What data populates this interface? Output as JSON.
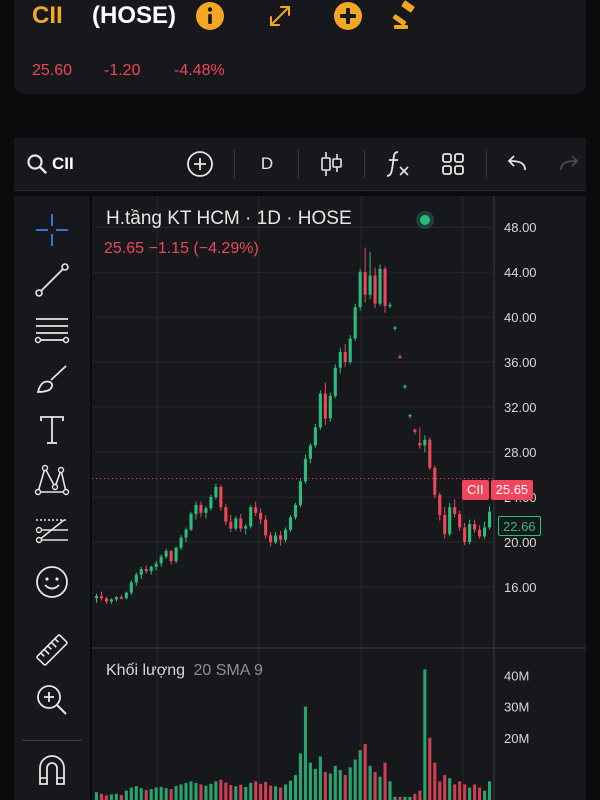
{
  "header": {
    "symbol": "CII",
    "exchange": "(HOSE)",
    "price": "25.60",
    "change": "-1.20",
    "change_pct": "-4.48%",
    "accent_color": "#f5a623",
    "down_color": "#f0455a",
    "icons": [
      "info-icon",
      "expand-icon",
      "add-circle-icon",
      "auction-icon"
    ]
  },
  "toolbar": {
    "search_symbol": "CII",
    "interval": "D",
    "icons": [
      "search-icon",
      "add-indicator-icon",
      "candles-icon",
      "fx-icon",
      "layout-icon",
      "undo-icon",
      "redo-icon"
    ]
  },
  "sidebar": {
    "tools": [
      "crosshair-icon",
      "trendline-icon",
      "fib-lines-icon",
      "brush-icon",
      "text-icon",
      "pattern-icon",
      "forecast-icon",
      "emoji-icon",
      "ruler-icon",
      "zoom-icon",
      "magnet-icon"
    ]
  },
  "chart": {
    "title": "H.tầng KT HCM · 1D · HOSE",
    "ohlc_line": "25.65  −1.15 (−4.29%)",
    "last_label": "CII",
    "last_price": "25.65",
    "ma_price": "22.66",
    "price_axis": [
      "48.00",
      "44.00",
      "40.00",
      "36.00",
      "32.00",
      "28.00",
      "24.00",
      "20.00",
      "16.00"
    ],
    "volume_title": "Khối lượng",
    "volume_params": "20 SMA 9",
    "volume_axis": [
      "40M",
      "30M",
      "20M"
    ],
    "up_color": "#2bbd7e",
    "down_color": "#f0455a"
  },
  "chart_data": {
    "type": "candlestick",
    "ylim": [
      12,
      49
    ],
    "y_ticks": [
      16,
      20,
      24,
      28,
      32,
      36,
      40,
      44,
      48
    ],
    "volume_ylim": [
      0,
      45
    ],
    "candles": [
      [
        15.0,
        15.4,
        14.6,
        15.2
      ],
      [
        15.2,
        15.6,
        14.8,
        15.0
      ],
      [
        15.0,
        15.1,
        14.5,
        14.7
      ],
      [
        14.7,
        15.0,
        14.5,
        14.9
      ],
      [
        14.9,
        15.2,
        14.7,
        15.1
      ],
      [
        15.1,
        15.3,
        14.9,
        15.0
      ],
      [
        15.0,
        15.6,
        14.9,
        15.5
      ],
      [
        15.5,
        16.6,
        15.3,
        16.4
      ],
      [
        16.4,
        17.3,
        16.1,
        17.1
      ],
      [
        17.1,
        17.8,
        16.7,
        17.6
      ],
      [
        17.6,
        17.9,
        17.2,
        17.4
      ],
      [
        17.4,
        17.9,
        17.1,
        17.8
      ],
      [
        17.8,
        18.3,
        17.5,
        18.1
      ],
      [
        18.1,
        18.9,
        17.8,
        18.7
      ],
      [
        18.7,
        19.4,
        18.5,
        19.2
      ],
      [
        19.2,
        19.3,
        18.0,
        18.3
      ],
      [
        18.3,
        19.6,
        18.1,
        19.5
      ],
      [
        19.5,
        20.6,
        19.3,
        20.4
      ],
      [
        20.4,
        21.3,
        20.0,
        21.1
      ],
      [
        21.1,
        22.7,
        21.0,
        22.5
      ],
      [
        22.5,
        23.6,
        22.0,
        23.3
      ],
      [
        23.3,
        23.6,
        22.2,
        22.6
      ],
      [
        22.6,
        23.2,
        22.1,
        23.0
      ],
      [
        23.0,
        24.2,
        22.8,
        24.0
      ],
      [
        24.0,
        25.2,
        23.8,
        24.9
      ],
      [
        24.9,
        25.1,
        22.8,
        23.1
      ],
      [
        23.1,
        23.4,
        21.5,
        21.8
      ],
      [
        21.8,
        22.4,
        20.9,
        21.2
      ],
      [
        21.2,
        22.3,
        21.0,
        22.1
      ],
      [
        22.1,
        22.5,
        20.9,
        21.2
      ],
      [
        21.2,
        21.6,
        20.7,
        21.4
      ],
      [
        21.4,
        23.3,
        21.2,
        23.1
      ],
      [
        23.1,
        23.6,
        22.3,
        22.6
      ],
      [
        22.6,
        23.0,
        21.6,
        22.0
      ],
      [
        22.0,
        22.4,
        20.3,
        20.6
      ],
      [
        20.6,
        20.9,
        19.6,
        20.0
      ],
      [
        20.0,
        20.9,
        19.8,
        20.6
      ],
      [
        20.6,
        21.0,
        19.7,
        20.2
      ],
      [
        20.2,
        21.3,
        20.0,
        21.1
      ],
      [
        21.1,
        22.4,
        20.9,
        22.2
      ],
      [
        22.2,
        23.5,
        22.0,
        23.3
      ],
      [
        23.3,
        25.6,
        23.1,
        25.4
      ],
      [
        25.4,
        27.8,
        25.2,
        27.4
      ],
      [
        27.4,
        28.8,
        27.0,
        28.6
      ],
      [
        28.6,
        30.5,
        28.4,
        30.2
      ],
      [
        30.2,
        33.5,
        30.0,
        33.2
      ],
      [
        33.2,
        34.2,
        30.4,
        31.0
      ],
      [
        31.0,
        33.3,
        30.7,
        33.0
      ],
      [
        33.0,
        35.8,
        32.8,
        35.5
      ],
      [
        35.5,
        37.3,
        35.0,
        36.9
      ],
      [
        36.9,
        37.6,
        35.6,
        36.0
      ],
      [
        36.0,
        38.4,
        35.8,
        38.1
      ],
      [
        38.1,
        41.2,
        37.9,
        40.9
      ],
      [
        40.9,
        44.3,
        40.6,
        44.0
      ],
      [
        44.0,
        46.2,
        41.3,
        42.0
      ],
      [
        42.0,
        45.8,
        41.6,
        43.7
      ],
      [
        43.7,
        44.4,
        40.8,
        41.2
      ],
      [
        41.2,
        44.7,
        41.0,
        44.3
      ],
      [
        44.3,
        44.5,
        40.4,
        41.0
      ],
      [
        41.0,
        41.3,
        40.8,
        41.1
      ],
      [
        39.0,
        39.2,
        38.8,
        39.1
      ],
      [
        36.5,
        36.7,
        36.3,
        36.4
      ],
      [
        33.8,
        34.0,
        33.6,
        33.9
      ],
      [
        31.2,
        31.4,
        31.0,
        31.3
      ],
      [
        30.0,
        30.1,
        29.6,
        29.8
      ],
      [
        28.8,
        30.2,
        28.3,
        28.6
      ],
      [
        28.6,
        29.5,
        28.0,
        29.1
      ],
      [
        29.1,
        29.3,
        26.4,
        26.6
      ],
      [
        26.6,
        26.8,
        23.9,
        24.2
      ],
      [
        24.2,
        24.4,
        21.9,
        22.4
      ],
      [
        22.4,
        23.1,
        20.3,
        20.7
      ],
      [
        20.7,
        23.5,
        20.5,
        23.1
      ],
      [
        23.1,
        23.8,
        22.2,
        22.5
      ],
      [
        22.5,
        22.8,
        21.0,
        21.3
      ],
      [
        21.3,
        21.7,
        19.7,
        20.0
      ],
      [
        20.0,
        22.0,
        19.8,
        21.6
      ],
      [
        21.6,
        22.0,
        20.8,
        21.1
      ],
      [
        21.1,
        21.5,
        20.3,
        20.5
      ],
      [
        20.5,
        21.8,
        20.3,
        21.3
      ],
      [
        21.3,
        23.2,
        21.1,
        22.7
      ]
    ],
    "volume": [
      2.5,
      2.0,
      1.5,
      1.8,
      2.0,
      1.6,
      3.0,
      4.0,
      4.5,
      3.8,
      3.2,
      3.5,
      4.0,
      4.2,
      3.8,
      3.5,
      4.5,
      5.0,
      5.5,
      6.0,
      5.5,
      5.0,
      4.6,
      5.2,
      6.0,
      6.5,
      5.6,
      4.8,
      4.4,
      4.9,
      4.2,
      5.5,
      6.0,
      5.2,
      5.8,
      4.6,
      4.4,
      4.0,
      5.0,
      6.2,
      8.0,
      15.0,
      30.0,
      12.0,
      10.0,
      14.0,
      9.0,
      8.5,
      11.0,
      9.6,
      8.0,
      10.5,
      13.0,
      16.0,
      18.0,
      11.0,
      9.0,
      7.5,
      12.0,
      6.0,
      1.0,
      1.0,
      1.0,
      1.0,
      2.0,
      3.0,
      42.0,
      20.0,
      12.0,
      6.0,
      8.0,
      7.0,
      5.0,
      6.0,
      5.0,
      4.0,
      5.0,
      4.0,
      3.0,
      6.0
    ]
  }
}
